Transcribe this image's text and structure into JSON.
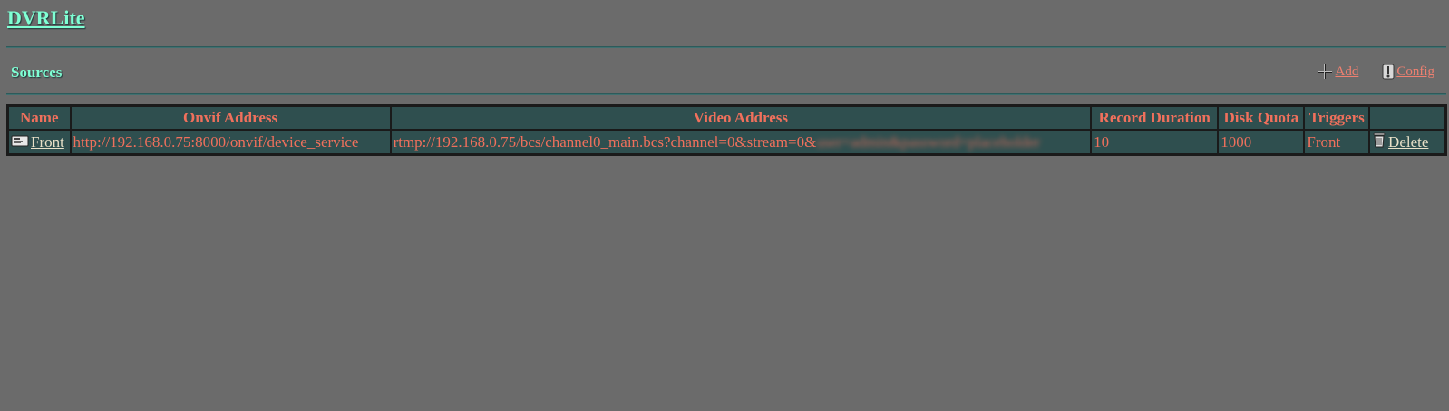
{
  "app": {
    "title": "DVRLite"
  },
  "sources_section": {
    "title": "Sources",
    "add_label": " Add",
    "config_label": " Config"
  },
  "table": {
    "headers": [
      "Name",
      "Onvif Address",
      "Video Address",
      "Record Duration",
      "Disk Quota",
      "Triggers",
      ""
    ],
    "rows": [
      {
        "name": "Front",
        "onvif_address": "http://192.168.0.75:8000/onvif/device_service",
        "video_address": "rtmp://192.168.0.75/bcs/channel0_main.bcs?channel=0&stream=0&",
        "video_address_hidden": "user=admin&password=placeholder",
        "record_duration": "10",
        "disk_quota": "1000",
        "triggers": "Front",
        "delete_label": " Delete"
      }
    ]
  },
  "colors": {
    "background": "#6b6b6b",
    "accent_title": "#7fffd4",
    "table_bg": "#2f4f4f",
    "table_text": "#f0705c",
    "link_text": "#e8e0c8"
  },
  "icons": {
    "add": "plus-icon",
    "config": "config-icon",
    "source": "camera-icon",
    "delete": "trash-icon"
  }
}
